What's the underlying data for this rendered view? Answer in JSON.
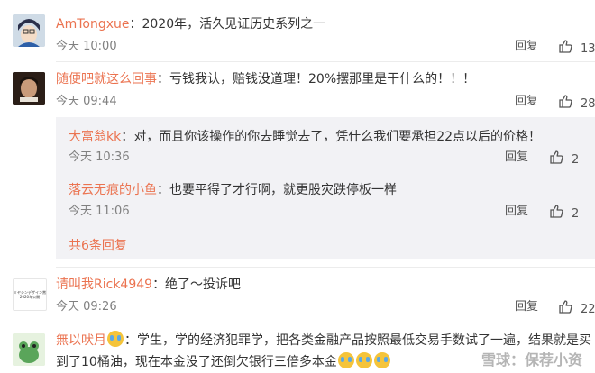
{
  "comments": [
    {
      "user": "AmTongxue",
      "text": "：2020年，活久见证历史系列之一",
      "time": "今天 10:00",
      "reply_label": "回复",
      "likes": "13"
    },
    {
      "user": "随便吧就这么回事",
      "text": "：亏钱我认，赔钱没道理！20%摆那里是干什么的！！！",
      "time": "今天 09:44",
      "reply_label": "回复",
      "likes": "28"
    },
    {
      "user": "请叫我Rick4949",
      "text": "：绝了～投诉吧",
      "time": "今天 09:26",
      "reply_label": "回复",
      "likes": "22"
    },
    {
      "user": "無以吠月",
      "text_line1": "：学生，学的经济犯罪学，把各类金融产品按照最低交易手数试了一遍，结果就是买",
      "text_line2": "到了10桶油，现在本金没了还倒欠银行三倍多本金"
    }
  ],
  "subreplies": [
    {
      "user": "大富翁kk",
      "text": "：对，而且你该操作的你去睡觉去了，凭什么我们要承担22点以后的价格！",
      "time": "今天 10:36",
      "reply_label": "回复",
      "likes": "2"
    },
    {
      "user": "落云无痕的小鱼",
      "text": "：也要平得了才行啊，就更股灾跌停板一样",
      "time": "今天 11:06",
      "reply_label": "回复",
      "likes": "2"
    }
  ],
  "more_replies": "共6条回复",
  "watermark": "雪球：保荐小资",
  "avatar_text": "ミヤシンデザイン賞 2020年公開",
  "colors": {
    "name": "#eb7350",
    "time": "#808080",
    "subbox": "#f2f2f5"
  }
}
